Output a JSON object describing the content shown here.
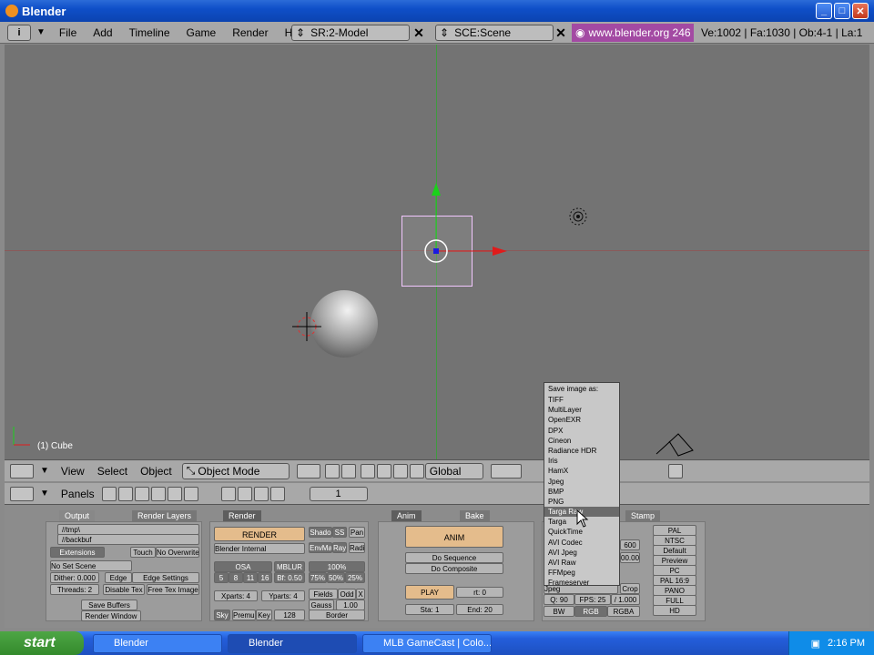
{
  "window": {
    "title": "Blender"
  },
  "menu": {
    "items": [
      "File",
      "Add",
      "Timeline",
      "Game",
      "Render",
      "Help"
    ]
  },
  "screen_field": {
    "value": "SR:2-Model"
  },
  "scene_field": {
    "value": "SCE:Scene"
  },
  "url": "www.blender.org 246",
  "stats": "Ve:1002 | Fa:1030 | Ob:4-1 | La:1",
  "viewport": {
    "object_label": "(1) Cube"
  },
  "header3d": {
    "view": "View",
    "select": "Select",
    "object": "Object",
    "mode": "Object Mode",
    "orientation": "Global"
  },
  "buttons_header": {
    "panels": "Panels",
    "frame": "1"
  },
  "output_panel": {
    "tab_output": "Output",
    "tab_render_layers": "Render Layers",
    "path1": "//tmp\\",
    "path2": "//backbuf",
    "extensions": "Extensions",
    "touch": "Touch",
    "no_overwrite": "No Overwrite",
    "no_set_scene": "No Set Scene",
    "dither": "Dither: 0.000",
    "edge": "Edge",
    "edge_settings": "Edge Settings",
    "threads": "Threads: 2",
    "disable_tex": "Disable Tex",
    "free_tex_image": "Free Tex Image",
    "save_buffers": "Save Buffers",
    "render_window": "Render Window"
  },
  "render_panel": {
    "tab": "Render",
    "tab_bake": "Bake",
    "render": "RENDER",
    "engine": "Blender Internal",
    "shado": "Shado",
    "ss": "SS",
    "pan": "Pan",
    "envma": "EnvMa",
    "ray": "Ray",
    "radi": "Radi",
    "osa": "OSA",
    "mblur": "MBLUR",
    "osa_vals": [
      "5",
      "8",
      "11",
      "16"
    ],
    "bf": "Bf: 0.50",
    "pct": "100%",
    "pct_vals": [
      "75%",
      "50%",
      "25%"
    ],
    "xparts": "Xparts: 4",
    "yparts": "Yparts: 4",
    "fields": "Fields",
    "odd": "Odd",
    "x": "X",
    "gauss": "Gauss",
    "gauss_val": "1.00",
    "sky": "Sky",
    "premul": "Premul",
    "key": "Key",
    "num128": "128",
    "border": "Border"
  },
  "anim_panel": {
    "tab": "Anim",
    "anim": "ANIM",
    "do_sequence": "Do Sequence",
    "do_composite": "Do Composite",
    "play": "PLAY",
    "rt": "rt: 0",
    "sta": "Sta: 1",
    "end": "End: 20"
  },
  "format_panel": {
    "tab_stamp": "Stamp",
    "presets": [
      "PAL",
      "NTSC",
      "Default",
      "Preview",
      "PC",
      "PAL 16:9",
      "PANO",
      "FULL",
      "HD"
    ],
    "size_a": "600",
    "size_b": "00.00",
    "crop": "Crop",
    "format": "Jpeg",
    "q": "Q: 90",
    "fps": "FPS: 25",
    "ratio": "/ 1.000",
    "bw": "BW",
    "rgb": "RGB",
    "rgba": "RGBA"
  },
  "save_dropdown": {
    "title": "Save image as:",
    "items": [
      "TIFF",
      "MultiLayer",
      "OpenEXR",
      "DPX",
      "Cineon",
      "Radiance HDR",
      "Iris",
      "HamX",
      "Jpeg",
      "BMP",
      "PNG",
      "Targa Raw",
      "Targa",
      "QuickTime",
      "AVI Codec",
      "AVI Jpeg",
      "AVI Raw",
      "FFMpeg",
      "Frameserver"
    ],
    "highlighted": "Targa Raw"
  },
  "taskbar": {
    "start": "start",
    "tasks": [
      "Blender",
      "Blender",
      "MLB GameCast | Colo..."
    ],
    "clock": "2:16 PM"
  },
  "colors": {
    "title": "#0f4fc8",
    "url": "#a34aa3",
    "viewport": "#737373"
  }
}
